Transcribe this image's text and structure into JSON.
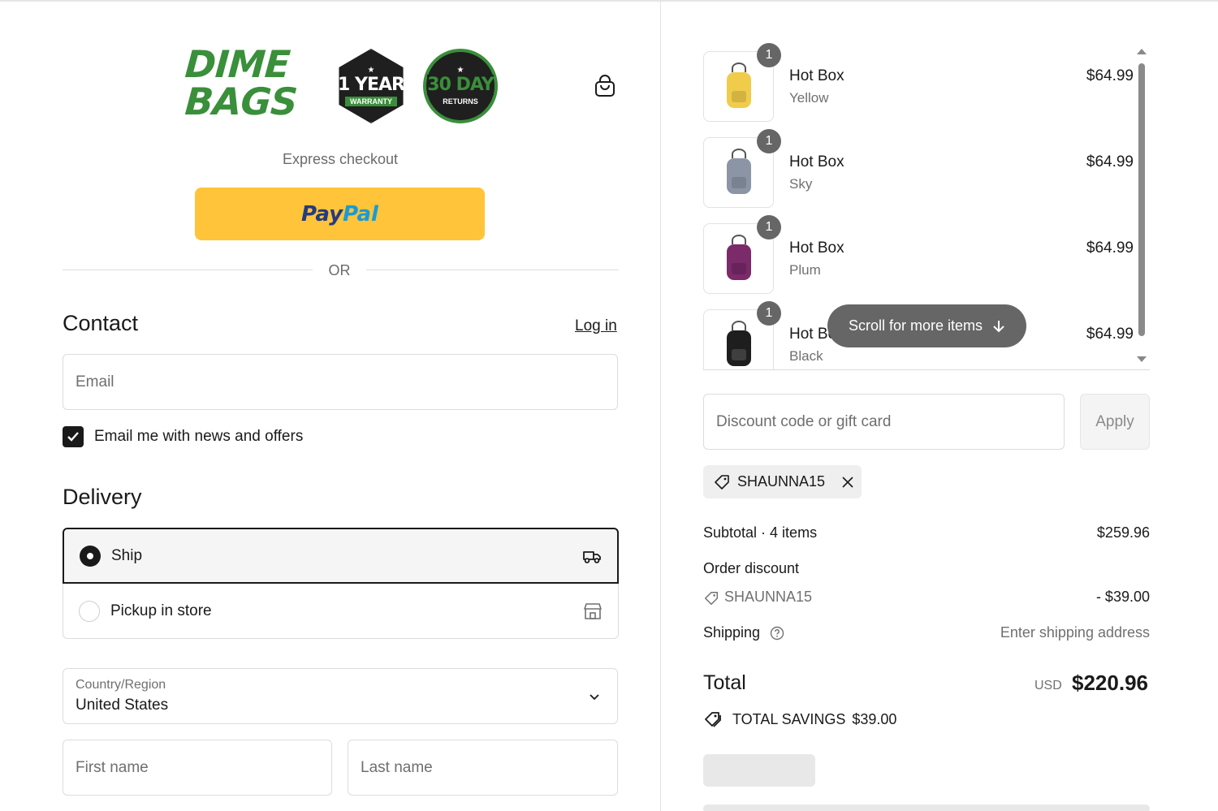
{
  "brand": {
    "name_line1": "DIME",
    "name_line2": "BAGS",
    "badge1_big": "1 YEAR",
    "badge1_small": "WARRANTY",
    "badge2_big": "30 DAY",
    "badge2_small": "RETURNS",
    "accent": "#3a8f3a"
  },
  "checkout": {
    "express_label": "Express checkout",
    "paypal_part1": "Pay",
    "paypal_part2": "Pal",
    "or_label": "OR"
  },
  "contact": {
    "heading": "Contact",
    "login_label": "Log in",
    "email_placeholder": "Email",
    "newsletter_label": "Email me with news and offers",
    "newsletter_checked": true
  },
  "delivery": {
    "heading": "Delivery",
    "options": [
      {
        "label": "Ship",
        "selected": true,
        "icon": "truck-icon"
      },
      {
        "label": "Pickup in store",
        "selected": false,
        "icon": "store-icon"
      }
    ],
    "country_label": "Country/Region",
    "country_value": "United States",
    "first_name_placeholder": "First name",
    "last_name_placeholder": "Last name"
  },
  "cart": {
    "items": [
      {
        "name": "Hot Box",
        "variant": "Yellow",
        "price": "$64.99",
        "qty": "1",
        "color": "#f0cc4a"
      },
      {
        "name": "Hot Box",
        "variant": "Sky",
        "price": "$64.99",
        "qty": "1",
        "color": "#8b95a6"
      },
      {
        "name": "Hot Box",
        "variant": "Plum",
        "price": "$64.99",
        "qty": "1",
        "color": "#7b2a6a"
      },
      {
        "name": "Hot Box",
        "variant": "Black",
        "price": "$64.99",
        "qty": "1",
        "color": "#1e1e1e"
      }
    ],
    "scroll_hint": "Scroll for more items"
  },
  "discount": {
    "placeholder": "Discount code or gift card",
    "apply_label": "Apply",
    "applied_code": "SHAUNNA15"
  },
  "summary": {
    "subtotal_label": "Subtotal · 4 items",
    "subtotal_value": "$259.96",
    "order_discount_label": "Order discount",
    "discount_code": "SHAUNNA15",
    "discount_value": "- $39.00",
    "shipping_label": "Shipping",
    "shipping_value": "Enter shipping address",
    "total_label": "Total",
    "currency": "USD",
    "total_value": "$220.96",
    "savings_label": "TOTAL SAVINGS",
    "savings_value": "$39.00"
  }
}
